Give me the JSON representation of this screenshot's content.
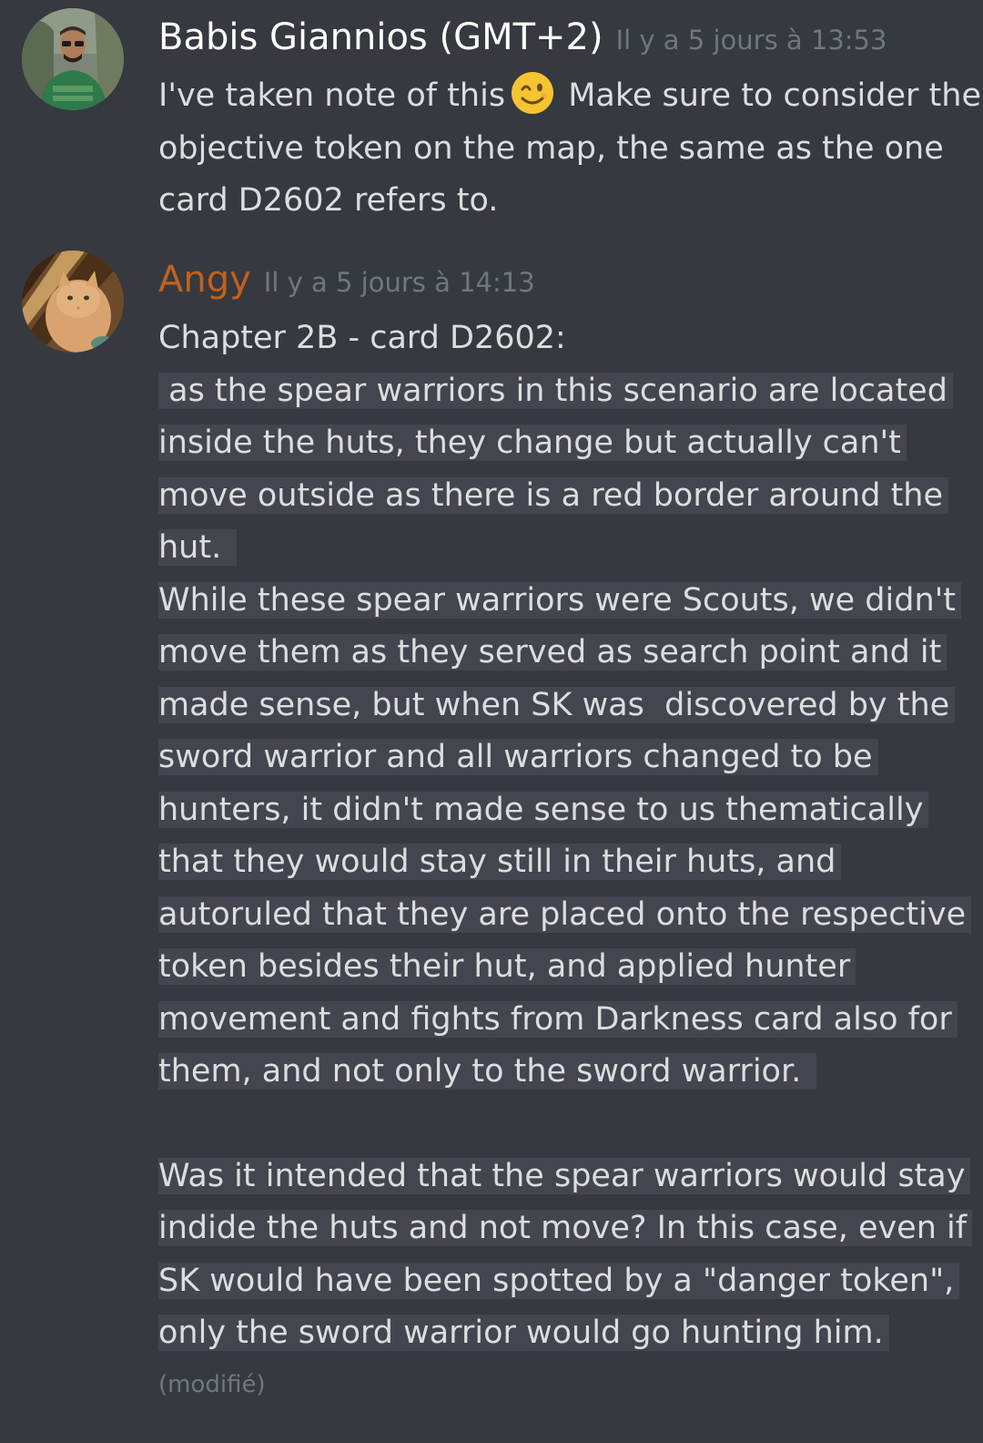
{
  "messages": [
    {
      "author": "Babis Giannios (GMT+2)",
      "timestamp": "Il y a 5 jours à 13:53",
      "text_before_emoji": "I've taken note of this",
      "emoji": "winking-face",
      "text_after_emoji": " Make sure to consider the",
      "lines": [
        "objective token on the map, the same as the one",
        "card D2602 refers to."
      ]
    },
    {
      "author": "Angy",
      "author_color": "#c2601f",
      "timestamp": "Il y a 5 jours à 14:13",
      "title_line": "Chapter 2B - card D2602:",
      "quoted_lines": [
        " as the spear warriors in this scenario are located",
        "inside the huts, they change but actually can't",
        "move outside as there is a red border around the",
        "hut. ",
        "While these spear warriors were Scouts, we didn't",
        "move them as they served as search point and it",
        "made sense, but when SK was  discovered by the",
        "sword warrior and all warriors changed to be",
        "hunters, it didn't made sense to us thematically",
        "that they would stay still in their huts, and",
        "autoruled that they are placed onto the respective",
        "token besides their hut, and applied hunter",
        "movement and fights from Darkness card also for",
        "them, and not only to the sword warrior. "
      ],
      "question_lines": [
        "Was it intended that the spear warriors would stay",
        "indide the huts and not move? In this case, even if",
        "SK would have been spotted by a \"danger token\",",
        "only the sword warrior would go hunting him."
      ],
      "edited_label": "(modifié)"
    }
  ]
}
